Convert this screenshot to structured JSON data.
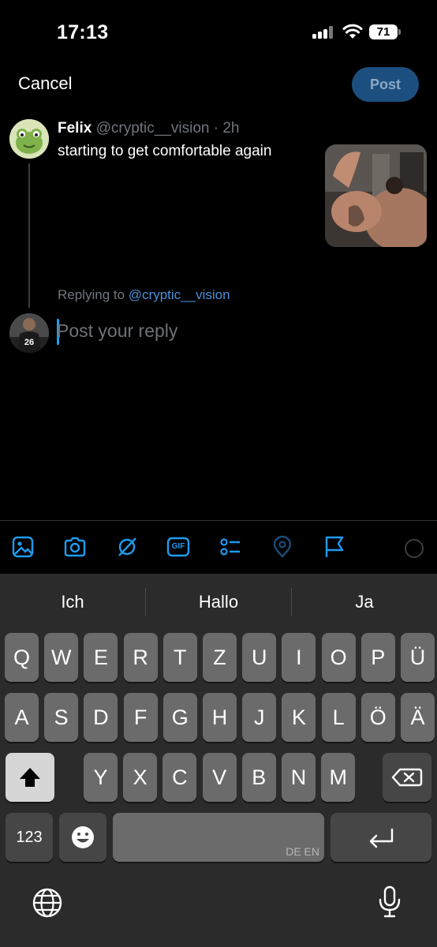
{
  "status_bar": {
    "time": "17:13",
    "battery": "71",
    "icons": [
      "signal-icon",
      "wifi-icon",
      "battery-icon"
    ]
  },
  "header": {
    "cancel_label": "Cancel",
    "post_label": "Post"
  },
  "original_tweet": {
    "name": "Felix",
    "meta": "@cryptic__vision · 2h",
    "text": "starting to get comfortable again"
  },
  "reply": {
    "replying_prefix": "Replying to ",
    "replying_handle": "@cryptic__vision",
    "placeholder": "Post your reply"
  },
  "toolbar": {
    "icons": [
      "image-icon",
      "camera-icon",
      "grok-icon",
      "gif-icon",
      "poll-icon",
      "location-icon",
      "flag-icon",
      "char-counter-icon"
    ],
    "gif_label": "GIF"
  },
  "keyboard": {
    "suggestions": [
      "Ich",
      "Hallo",
      "Ja"
    ],
    "row1": [
      "Q",
      "W",
      "E",
      "R",
      "T",
      "Z",
      "U",
      "I",
      "O",
      "P",
      "Ü"
    ],
    "row2": [
      "A",
      "S",
      "D",
      "F",
      "G",
      "H",
      "J",
      "K",
      "L",
      "Ö",
      "Ä"
    ],
    "row3": [
      "Y",
      "X",
      "C",
      "V",
      "B",
      "N",
      "M"
    ],
    "numbers_label": "123",
    "space_language": "DE EN",
    "colors": {
      "background": "#2b2b2b",
      "key": "#6b6b6b",
      "key_dark": "#464646",
      "accent": "#1d9bf0"
    }
  }
}
